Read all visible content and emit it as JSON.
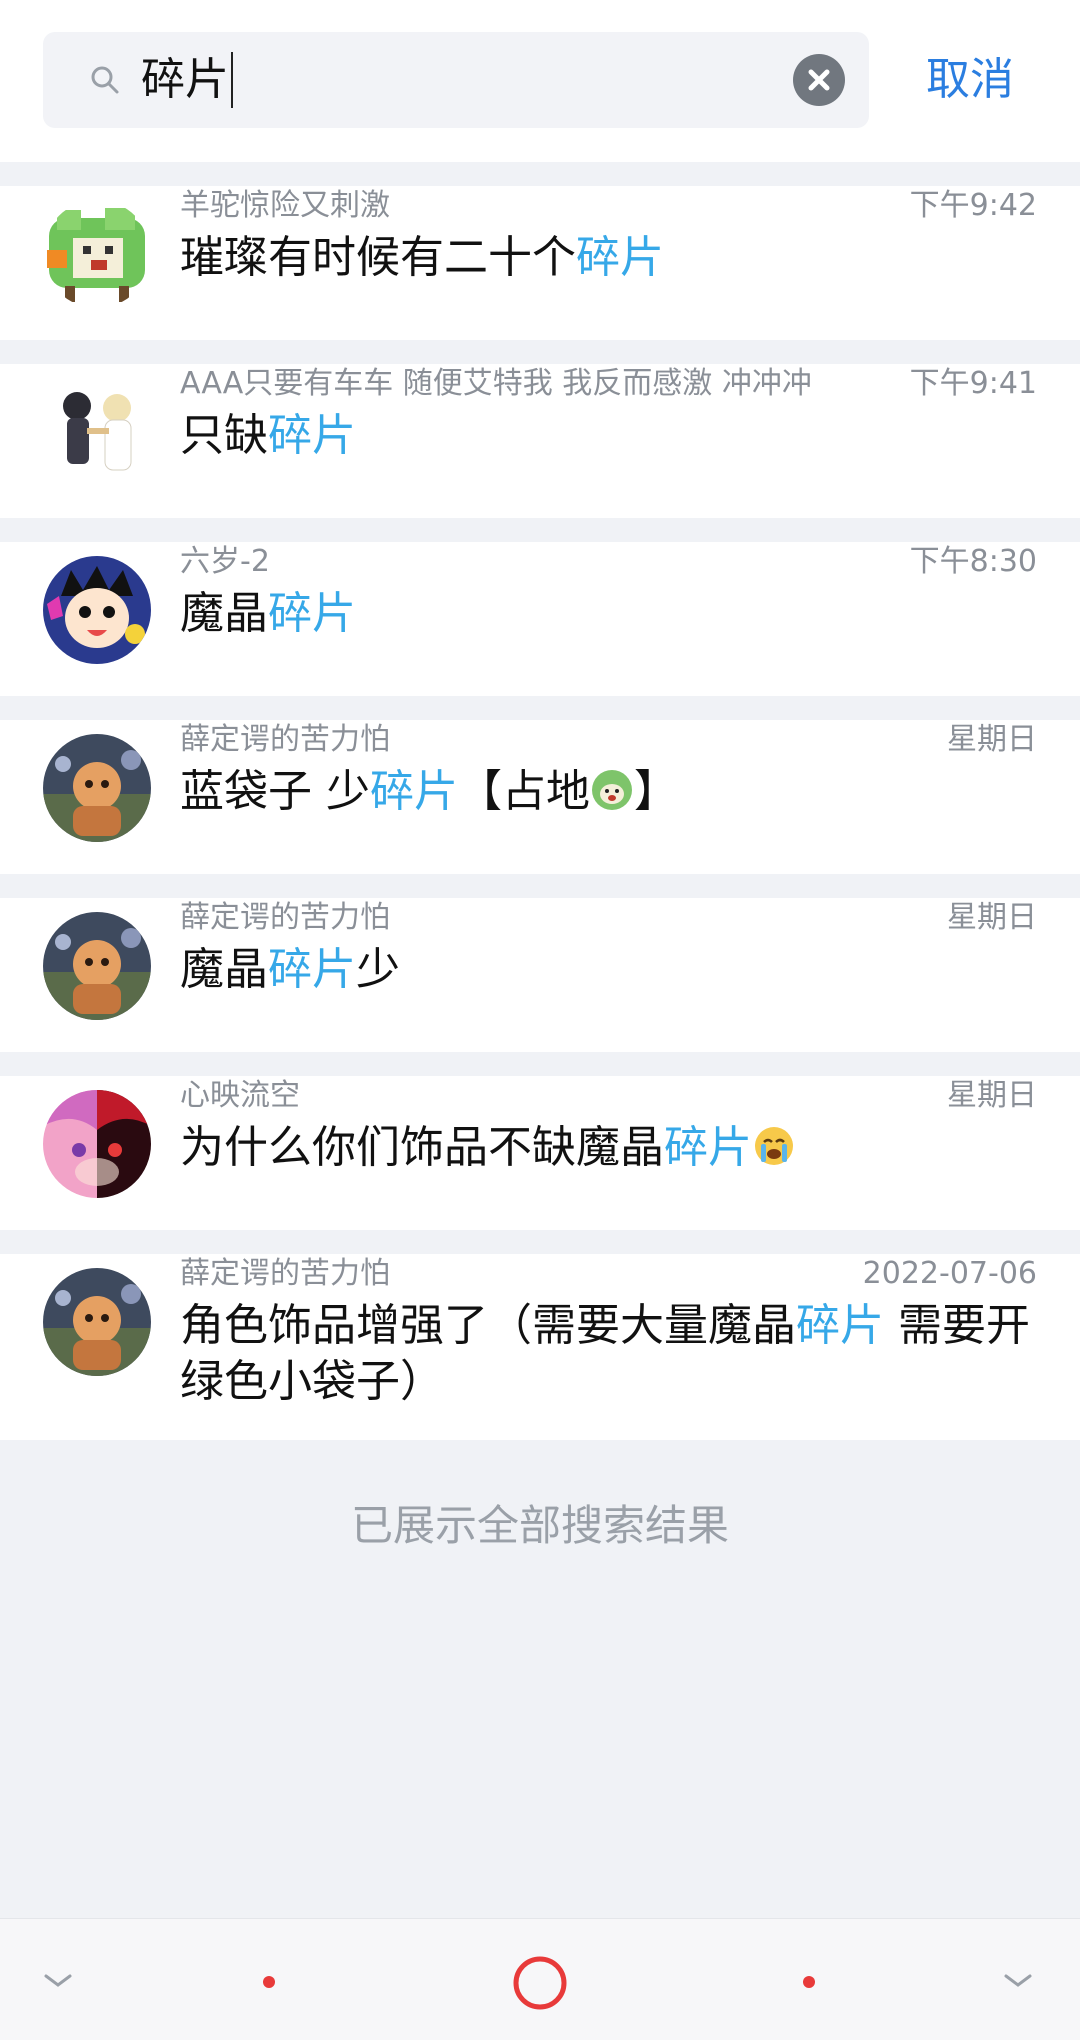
{
  "search": {
    "query": "碎片",
    "cancel_label": "取消"
  },
  "results": [
    {
      "sender": "羊驼惊险又刺激",
      "time": "下午9:42",
      "before": "璀璨有时候有二十个",
      "highlight": "碎片",
      "after": ""
    },
    {
      "sender": "AAA只要有车车 随便艾特我 我反而感激 冲冲冲",
      "time": "下午9:41",
      "before": "只缺",
      "highlight": "碎片",
      "after": ""
    },
    {
      "sender": "六岁-2",
      "time": "下午8:30",
      "before": "魔晶",
      "highlight": "碎片",
      "after": ""
    },
    {
      "sender": "薛定谔的苦力怕",
      "time": "星期日",
      "before": "蓝袋子 少",
      "highlight": "碎片",
      "after": "【占地",
      "after2": "】"
    },
    {
      "sender": "薛定谔的苦力怕",
      "time": "星期日",
      "before": "魔晶",
      "highlight": "碎片",
      "after": "少"
    },
    {
      "sender": "心映流空",
      "time": "星期日",
      "before": "为什么你们饰品不缺魔晶",
      "highlight": "碎片",
      "after": ""
    },
    {
      "sender": "薛定谔的苦力怕",
      "time": "2022-07-06",
      "before": "角色饰品增强了（需要大量魔晶",
      "highlight": "碎片",
      "after": " 需要开绿色小袋子）"
    }
  ],
  "footer": {
    "end_text": "已展示全部搜索结果"
  },
  "colors": {
    "highlight": "#36a8e8",
    "accent": "#2b7ee0",
    "nav_red": "#e83a3a"
  }
}
